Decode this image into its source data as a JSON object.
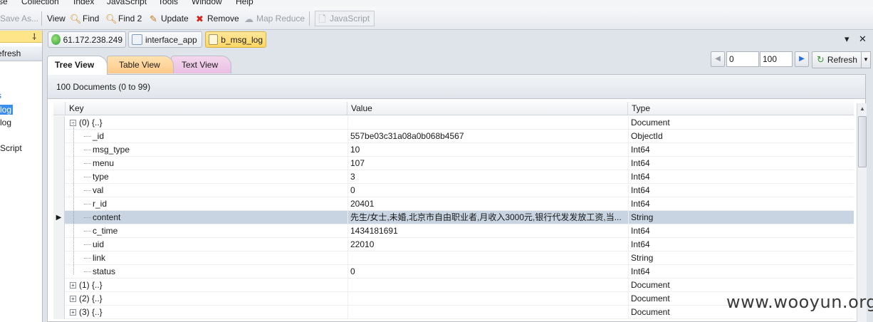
{
  "menu": [
    "se",
    "Collection",
    "Index",
    "JavaScript",
    "Tools",
    "Window",
    "Help"
  ],
  "toolbar": {
    "save_as": "Save As...",
    "view": "View",
    "find": "Find",
    "find2": "Find 2",
    "update": "Update",
    "remove": "Remove",
    "map_reduce": "Map Reduce",
    "javascript": "JavaScript"
  },
  "left_panel": {
    "refresh": "efresh",
    "items": [
      "s",
      "log",
      "log",
      "Script"
    ]
  },
  "connection_tabs": [
    "61.172.238.249",
    "interface_app",
    "b_msg_log"
  ],
  "view_tabs": [
    "Tree View",
    "Table View",
    "Text View"
  ],
  "pager": {
    "from": "0",
    "count": "100",
    "refresh": "Refresh"
  },
  "doc_summary": "100 Documents (0 to 99)",
  "columns": [
    "Key",
    "Value",
    "Type"
  ],
  "rows": [
    {
      "key": "(0) {..}",
      "value": "",
      "type": "Document",
      "expanded": true,
      "level": 0
    },
    {
      "key": "_id",
      "value": "557be03c31a08a0b068b4567",
      "type": "ObjectId",
      "level": 1
    },
    {
      "key": "msg_type",
      "value": "10",
      "type": "Int64",
      "level": 1
    },
    {
      "key": "menu",
      "value": "107",
      "type": "Int64",
      "level": 1
    },
    {
      "key": "type",
      "value": "3",
      "type": "Int64",
      "level": 1
    },
    {
      "key": "val",
      "value": "0",
      "type": "Int64",
      "level": 1
    },
    {
      "key": "r_id",
      "value": "20401",
      "type": "Int64",
      "level": 1
    },
    {
      "key": "content",
      "value": "先生/女士,未婚,北京市自由职业者,月收入3000元,银行代发发放工资,当...",
      "type": "String",
      "level": 1,
      "selected": true
    },
    {
      "key": "c_time",
      "value": "1434181691",
      "type": "Int64",
      "level": 1
    },
    {
      "key": "uid",
      "value": "22010",
      "type": "Int64",
      "level": 1
    },
    {
      "key": "link",
      "value": "",
      "type": "String",
      "level": 1
    },
    {
      "key": "status",
      "value": "0",
      "type": "Int64",
      "level": 1
    },
    {
      "key": "(1) {..}",
      "value": "",
      "type": "Document",
      "expanded": false,
      "level": 0
    },
    {
      "key": "(2) {..}",
      "value": "",
      "type": "Document",
      "expanded": false,
      "level": 0
    },
    {
      "key": "(3) {..}",
      "value": "",
      "type": "Document",
      "expanded": false,
      "level": 0
    }
  ],
  "watermark": "www.wooyun.org"
}
